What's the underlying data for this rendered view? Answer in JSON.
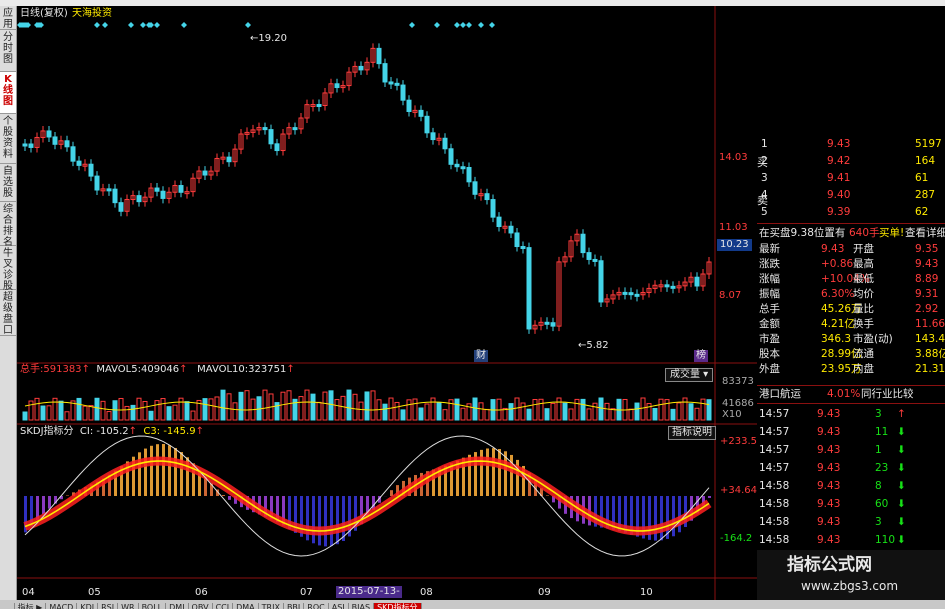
{
  "sidebar": {
    "tabs": [
      "应用",
      "分时图",
      "K线图",
      "个股资料",
      "自选股",
      "综合排名",
      "牛叉诊股",
      "超级盘口"
    ],
    "active": 2
  },
  "header": {
    "period": "日线(复权)",
    "stock_name": "天海投资"
  },
  "price_panel": {
    "axis": [
      "14.03",
      "11.03",
      "10.23",
      "8.07"
    ],
    "high_label": "19.20",
    "low_label": "5.82",
    "markers": [
      "财",
      "榜"
    ]
  },
  "volume_panel": {
    "label": "总手:",
    "value": "591383",
    "ma5_label": "MAVOL5:",
    "ma5": "409046",
    "ma10_label": "MAVOL10:",
    "ma10": "323751",
    "button": "成交量",
    "axis": [
      "83373",
      "41686",
      "X10"
    ]
  },
  "indicator_panel": {
    "name": "SKDJ指标分",
    "ci_label": "CI:",
    "ci": "-105.2",
    "c3_label": "C3:",
    "c3": "-145.9",
    "button": "指标说明",
    "axis": [
      "+233.5",
      "+34.64",
      "-164.2"
    ]
  },
  "x_axis": {
    "labels": [
      "04",
      "05",
      "06",
      "07",
      "08",
      "09",
      "10"
    ],
    "date_box": "2015-07-13-"
  },
  "order_book": {
    "sell_label": "卖",
    "buy_label": "买",
    "rows": [
      {
        "level": "1",
        "price": "9.43",
        "vol": "5197"
      },
      {
        "level": "2",
        "price": "9.42",
        "vol": "164"
      },
      {
        "level": "3",
        "price": "9.41",
        "vol": "61"
      },
      {
        "level": "4",
        "price": "9.40",
        "vol": "287"
      },
      {
        "level": "5",
        "price": "9.39",
        "vol": "62"
      }
    ],
    "note_a": "在买盘9.38位置有",
    "note_b": "640手",
    "note_c": "买单!",
    "note_link": "查看详细"
  },
  "stats": [
    [
      "最新",
      "9.43",
      "开盘",
      "9.35"
    ],
    [
      "涨跌",
      "+0.86",
      "最高",
      "9.43"
    ],
    [
      "涨幅",
      "+10.04%",
      "最低",
      "8.89"
    ],
    [
      "振幅",
      "6.30%",
      "均价",
      "9.31"
    ],
    [
      "总手",
      "45.26万",
      "量比",
      "2.92"
    ],
    [
      "金额",
      "4.21亿",
      "换手",
      "11.66%"
    ],
    [
      "市盈",
      "346.3",
      "市盈(动)",
      "143.4"
    ],
    [
      "股本",
      "28.99亿",
      "流通",
      "3.88亿"
    ],
    [
      "外盘",
      "23.95万",
      "内盘",
      "21.31万"
    ]
  ],
  "sector": {
    "name": "港口航运",
    "change": "4.01%",
    "button": "同行业比较"
  },
  "ticks": [
    {
      "time": "14:57",
      "price": "9.43",
      "vol": "3",
      "dir": "up"
    },
    {
      "time": "14:57",
      "price": "9.43",
      "vol": "11",
      "dir": "down"
    },
    {
      "time": "14:57",
      "price": "9.43",
      "vol": "1",
      "dir": "down"
    },
    {
      "time": "14:57",
      "price": "9.43",
      "vol": "23",
      "dir": "down"
    },
    {
      "time": "14:58",
      "price": "9.43",
      "vol": "8",
      "dir": "down"
    },
    {
      "time": "14:58",
      "price": "9.43",
      "vol": "60",
      "dir": "down"
    },
    {
      "time": "14:58",
      "price": "9.43",
      "vol": "3",
      "dir": "down"
    },
    {
      "time": "14:58",
      "price": "9.43",
      "vol": "110",
      "dir": "down"
    }
  ],
  "watermark": {
    "title": "指标公式网",
    "url": "www.zbgs3.com"
  },
  "bottom_tabs": [
    "...",
    "指标 ▶",
    "MACD",
    "KDJ",
    "RSI",
    "WR",
    "BOLL",
    "DMI",
    "OBV",
    "CCI",
    "DMA",
    "TRIX",
    "BBI",
    "ROC",
    "ASI",
    "BIAS",
    "SKD指标分"
  ],
  "colors": {
    "up": "#ff3c3c",
    "down": "#44d4e8",
    "ma": "#ffea00",
    "green": "#17e017"
  }
}
